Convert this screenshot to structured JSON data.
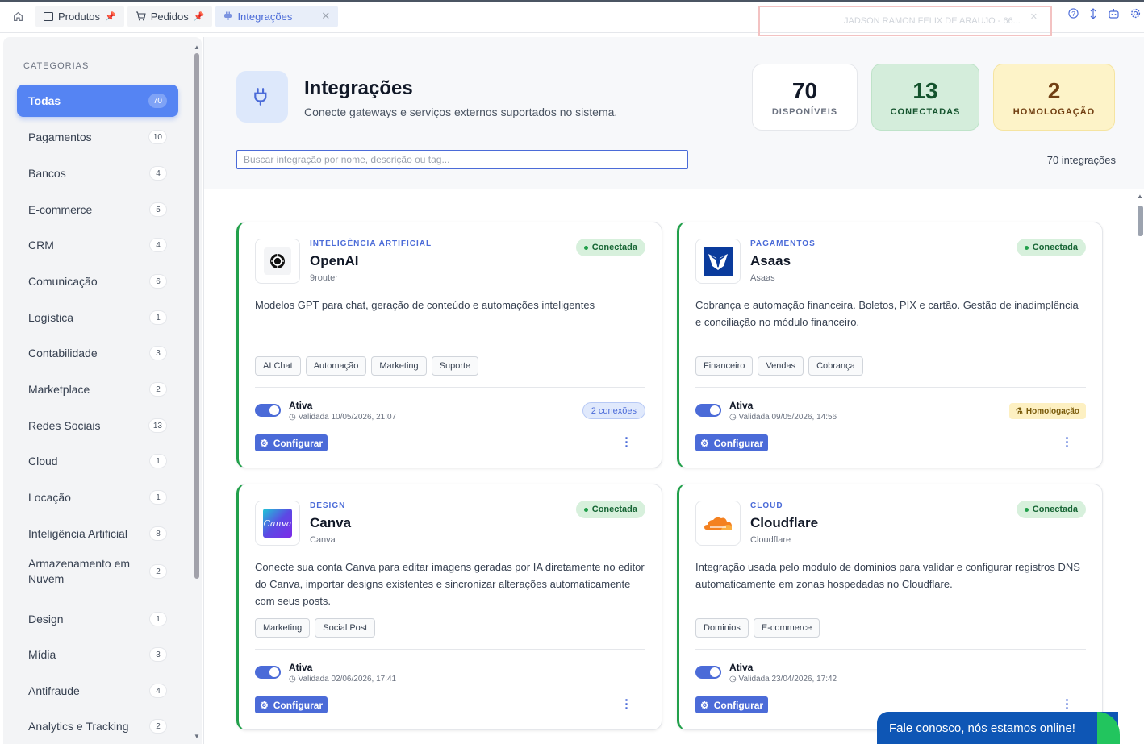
{
  "tabs": [
    {
      "label": "Produtos",
      "icon": "window-icon"
    },
    {
      "label": "Pedidos",
      "icon": "cart-icon"
    },
    {
      "label": "Integrações",
      "icon": "plug-icon",
      "active": true
    }
  ],
  "user": {
    "name": "JADSON RAMON FELIX DE ARAUJO - 66..."
  },
  "sidebar": {
    "title": "CATEGORIAS",
    "items": [
      {
        "label": "Todas",
        "count": "70",
        "active": true
      },
      {
        "label": "Pagamentos",
        "count": "10"
      },
      {
        "label": "Bancos",
        "count": "4"
      },
      {
        "label": "E-commerce",
        "count": "5"
      },
      {
        "label": "CRM",
        "count": "4"
      },
      {
        "label": "Comunicação",
        "count": "6"
      },
      {
        "label": "Logística",
        "count": "1"
      },
      {
        "label": "Contabilidade",
        "count": "3"
      },
      {
        "label": "Marketplace",
        "count": "2"
      },
      {
        "label": "Redes Sociais",
        "count": "13"
      },
      {
        "label": "Cloud",
        "count": "1"
      },
      {
        "label": "Locação",
        "count": "1"
      },
      {
        "label": "Inteligência Artificial",
        "count": "8"
      },
      {
        "label": "Armazenamento em Nuvem",
        "count": "2"
      },
      {
        "label": "Design",
        "count": "1"
      },
      {
        "label": "Mídia",
        "count": "3"
      },
      {
        "label": "Antifraude",
        "count": "4"
      },
      {
        "label": "Analytics e Tracking",
        "count": "2"
      }
    ]
  },
  "header": {
    "title": "Integrações",
    "subtitle": "Conecte gateways e serviços externos suportados no sistema.",
    "search_placeholder": "Buscar integração por nome, descrição ou tag...",
    "total": "70 integrações",
    "stats": [
      {
        "value": "70",
        "label": "DISPONÍVEIS",
        "bg": "#ffffff",
        "fg": "#111827"
      },
      {
        "value": "13",
        "label": "CONECTADAS",
        "bg": "#d4eddb",
        "fg": "#14532d"
      },
      {
        "value": "2",
        "label": "HOMOLOGAÇÃO",
        "bg": "#fdf3c8",
        "fg": "#713f12"
      }
    ]
  },
  "cards": [
    {
      "category": "INTELIGÊNCIA ARTIFICIAL",
      "name": "OpenAI",
      "provider": "9router",
      "status": "Conectada",
      "description": "Modelos GPT para chat, geração de conteúdo e automações inteligentes",
      "tags": [
        "AI Chat",
        "Automação",
        "Marketing",
        "Suporte"
      ],
      "active_label": "Ativa",
      "validated": "Validada 10/05/2026, 21:07",
      "connections": "2 conexões",
      "configure": "Configurar"
    },
    {
      "category": "PAGAMENTOS",
      "name": "Asaas",
      "provider": "Asaas",
      "status": "Conectada",
      "description": "Cobrança e automação financeira. Boletos, PIX e cartão. Gestão de inadimplência e conciliação no módulo financeiro.",
      "tags": [
        "Financeiro",
        "Vendas",
        "Cobrança"
      ],
      "active_label": "Ativa",
      "validated": "Validada 09/05/2026, 14:56",
      "homologation": "Homologação",
      "configure": "Configurar"
    },
    {
      "category": "DESIGN",
      "name": "Canva",
      "provider": "Canva",
      "logo_text": "Canva",
      "status": "Conectada",
      "description": "Conecte sua conta Canva para editar imagens geradas por IA diretamente no editor do Canva, importar designs existentes e sincronizar alterações automaticamente com seus posts.",
      "tags": [
        "Marketing",
        "Social Post"
      ],
      "active_label": "Ativa",
      "validated": "Validada 02/06/2026, 17:41",
      "configure": "Configurar"
    },
    {
      "category": "CLOUD",
      "name": "Cloudflare",
      "provider": "Cloudflare",
      "status": "Conectada",
      "description": "Integração usada pelo modulo de dominios para validar e configurar registros DNS automaticamente em zonas hospedadas no Cloudflare.",
      "tags": [
        "Dominios",
        "E-commerce"
      ],
      "active_label": "Ativa",
      "validated": "Validada 23/04/2026, 17:42",
      "configure": "Configurar"
    }
  ],
  "chat": {
    "label": "Fale conosco, nós estamos online!"
  }
}
